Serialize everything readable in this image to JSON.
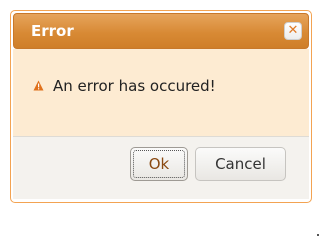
{
  "dialog": {
    "title": "Error",
    "close_icon": "close-x-icon",
    "message_icon": "warning-triangle-icon",
    "message": "An error has occured!",
    "buttons": {
      "ok_label": "Ok",
      "cancel_label": "Cancel"
    },
    "colors": {
      "title_bar": "#d88a35",
      "title_text": "#ffffff",
      "content_bg": "#fdebd2",
      "button_pane_bg": "#f4f2ee",
      "warning_icon": "#e0711c"
    }
  }
}
